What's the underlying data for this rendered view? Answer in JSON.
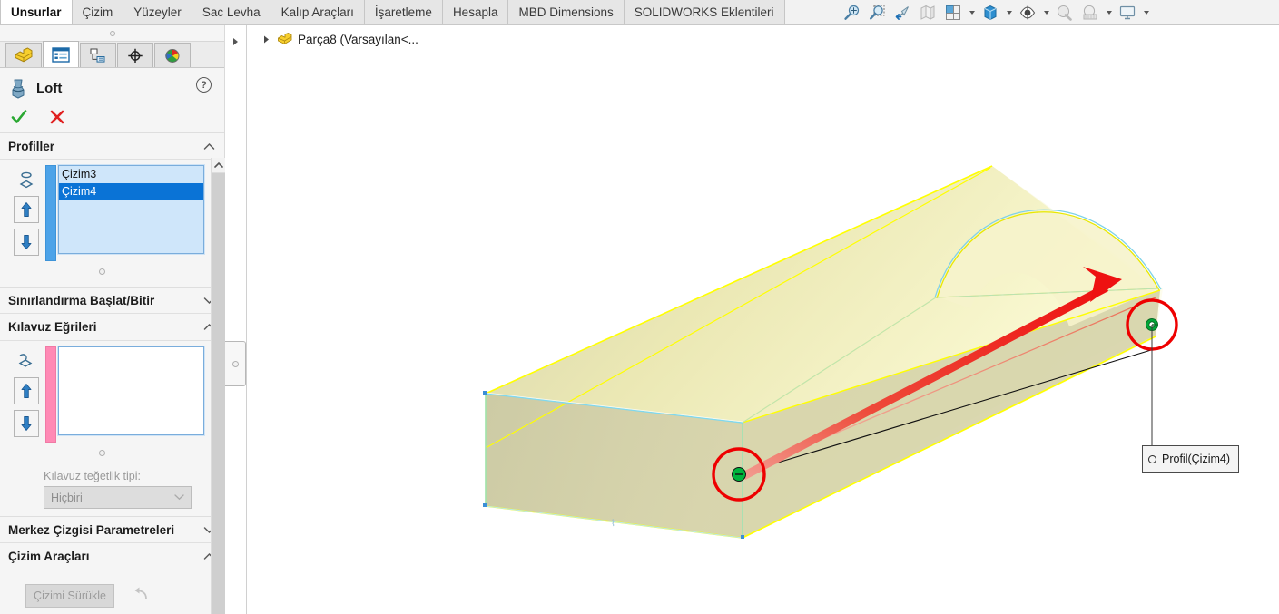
{
  "command_tabs": [
    {
      "label": "Unsurlar",
      "active": true
    },
    {
      "label": "Çizim",
      "active": false
    },
    {
      "label": "Yüzeyler",
      "active": false
    },
    {
      "label": "Sac Levha",
      "active": false
    },
    {
      "label": "Kalıp Araçları",
      "active": false
    },
    {
      "label": "İşaretleme",
      "active": false
    },
    {
      "label": "Hesapla",
      "active": false
    },
    {
      "label": "MBD Dimensions",
      "active": false
    },
    {
      "label": "SOLIDWORKS Eklentileri",
      "active": false
    }
  ],
  "view_toolbar": [
    {
      "name": "zoom-to-fit-icon",
      "caret": false
    },
    {
      "name": "zoom-to-area-icon",
      "caret": false
    },
    {
      "name": "previous-view-icon",
      "caret": false
    },
    {
      "name": "section-view-icon",
      "caret": false
    },
    {
      "name": "view-orientation-icon",
      "caret": true
    },
    {
      "name": "display-style-icon",
      "caret": true
    },
    {
      "name": "hide-show-items-icon",
      "caret": true
    },
    {
      "name": "edit-appearance-icon",
      "caret": false
    },
    {
      "name": "apply-scene-icon",
      "caret": true
    },
    {
      "name": "view-settings-icon",
      "caret": true
    }
  ],
  "property_manager": {
    "tabs": [
      {
        "name": "feature-manager-tree-tab",
        "active": false
      },
      {
        "name": "property-manager-tab",
        "active": true
      },
      {
        "name": "configuration-manager-tab",
        "active": false
      },
      {
        "name": "dimxpert-manager-tab",
        "active": false
      },
      {
        "name": "appearances-manager-tab",
        "active": false
      }
    ],
    "title": "Loft",
    "help_label": "?",
    "ok_label": "✔",
    "cancel_label": "✘",
    "sections": {
      "profiles": {
        "title": "Profiller",
        "expanded": true,
        "items": [
          {
            "label": "Çizim3",
            "selected": false
          },
          {
            "label": "Çizim4",
            "selected": true
          }
        ],
        "move_up_label": "⇧",
        "move_down_label": "⇩",
        "color": "#4da3e8"
      },
      "start_end_constraints": {
        "title": "Sınırlandırma Başlat/Bitir",
        "expanded": false
      },
      "guide_curves": {
        "title": "Kılavuz Eğrileri",
        "expanded": true,
        "items": [],
        "move_up_label": "⇧",
        "move_down_label": "⇩",
        "color": "#ff8ab5",
        "tangency_label": "Kılavuz teğetlik tipi:",
        "tangency_value": "Hiçbiri"
      },
      "centerline_parameters": {
        "title": "Merkez Çizgisi Parametreleri",
        "expanded": false
      },
      "sketch_tools": {
        "title": "Çizim Araçları",
        "expanded": true,
        "drag_sketch_label": "Çizimi Sürükle",
        "undo_label": "undo-sketch-drag-icon"
      }
    }
  },
  "feature_tree": {
    "root_label": "Parça8  (Varsayılan<...",
    "expand_icon": "expand-triangle-icon",
    "part_icon": "part-icon"
  },
  "viewport": {
    "callout_label": "Profil(Çizim4)",
    "connector_icon": "callout-connector-icon",
    "colors": {
      "surface_light": "#f7f4bb",
      "surface_mid": "#e8e4b0",
      "surface_dark": "#c9c7a4",
      "edge_yellow": "#ffff00",
      "edge_cyan": "#63d6f0",
      "selection_red": "#ee0000",
      "point_green": "#00b33c",
      "arrow_red": "#ee1111",
      "background": "#ffffff"
    }
  }
}
